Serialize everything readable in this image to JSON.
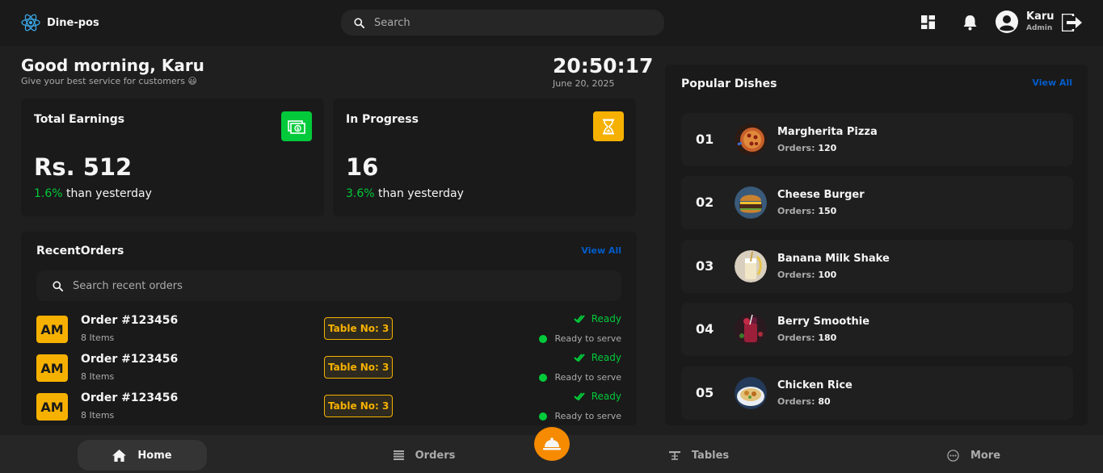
{
  "app": {
    "name": "Dine-pos"
  },
  "header": {
    "search_placeholder": "Search",
    "user_name": "Karu",
    "user_role": "Admin"
  },
  "greeting": {
    "title": "Good morning, Karu",
    "subtitle": "Give your best service for customers 😃"
  },
  "clock": {
    "time": "20:50:17",
    "date": "June 20, 2025"
  },
  "stats": [
    {
      "title": "Total Earnings",
      "value": "Rs. 512",
      "change": "1.6%",
      "change_text": "than yesterday",
      "icon": "money-icon",
      "color": "#02ca3a"
    },
    {
      "title": "In Progress",
      "value": "16",
      "change": "3.6%",
      "change_text": "than yesterday",
      "icon": "hourglass-icon",
      "color": "#f6b100"
    }
  ],
  "recent_orders": {
    "title": "RecentOrders",
    "view_all": "View All",
    "search_placeholder": "Search recent orders",
    "orders": [
      {
        "initials": "AM",
        "id": "Order #123456",
        "items": "8 Items",
        "table": "Table No: 3",
        "status": "Ready",
        "status_sub": "Ready to serve"
      },
      {
        "initials": "AM",
        "id": "Order #123456",
        "items": "8 Items",
        "table": "Table No: 3",
        "status": "Ready",
        "status_sub": "Ready to serve"
      },
      {
        "initials": "AM",
        "id": "Order #123456",
        "items": "8 Items",
        "table": "Table No: 3",
        "status": "Ready",
        "status_sub": "Ready to serve"
      }
    ]
  },
  "popular_dishes": {
    "title": "Popular Dishes",
    "view_all": "View All",
    "orders_label": "Orders:",
    "dishes": [
      {
        "num": "01",
        "name": "Margherita Pizza",
        "orders": "120"
      },
      {
        "num": "02",
        "name": "Cheese Burger",
        "orders": "150"
      },
      {
        "num": "03",
        "name": "Banana Milk Shake",
        "orders": "100"
      },
      {
        "num": "04",
        "name": "Berry Smoothie",
        "orders": "180"
      },
      {
        "num": "05",
        "name": "Chicken Rice",
        "orders": "80"
      }
    ]
  },
  "nav": {
    "home": "Home",
    "orders": "Orders",
    "tables": "Tables",
    "more": "More"
  },
  "colors": {
    "accent_green": "#02ca3a",
    "accent_yellow": "#f6b100",
    "accent_blue": "#025cca",
    "fab_orange": "#f68a00"
  }
}
